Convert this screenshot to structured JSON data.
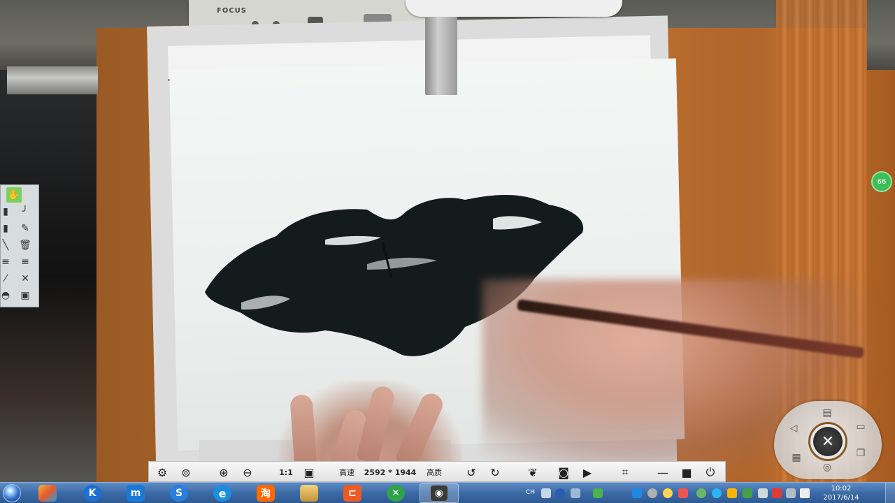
{
  "device": {
    "brand_label": "FOCUS"
  },
  "side_badge": {
    "text": "66"
  },
  "control_bar": {
    "ratio_label": "1:1",
    "speed_label": "高速",
    "resolution_label": "2592 * 1944",
    "quality_label": "高质"
  },
  "taskbar": {
    "apps": [
      {
        "name": "K",
        "color": "#1f6fd1"
      },
      {
        "name": "m",
        "color": "#1a79d8"
      },
      {
        "name": "S",
        "color": "#2a7fdc"
      },
      {
        "name": "e",
        "color": "#1a8ee0"
      },
      {
        "name": "淘",
        "color": "#ff6a00"
      },
      {
        "name": "",
        "color": "#d7a64a"
      },
      {
        "name": "",
        "color": "#ee5a24"
      },
      {
        "name": "",
        "color": "#2fa34a"
      },
      {
        "name": "",
        "color": "#444444"
      }
    ],
    "language_indicator": "CH",
    "clock_time": "10:02",
    "clock_date": "2017/6/14"
  },
  "icons": {
    "annotation": [
      "hand-icon",
      "pencil-icon",
      "pen-curve-icon",
      "marker-icon",
      "brush-icon",
      "line-icon",
      "trash-icon",
      "align-left-icon",
      "align-justify-icon",
      "eyedropper-icon",
      "expand-icon",
      "eraser-icon",
      "save-icon"
    ],
    "control_bar": [
      "settings-icon",
      "zoom-fit-icon",
      "zoom-in-icon",
      "zoom-out-icon",
      "fullscreen-icon",
      "rotate-left-icon",
      "rotate-right-icon",
      "butterfly-icon",
      "camera-icon",
      "video-icon",
      "crop-icon",
      "minimize-icon",
      "maximize-icon",
      "power-icon"
    ]
  }
}
